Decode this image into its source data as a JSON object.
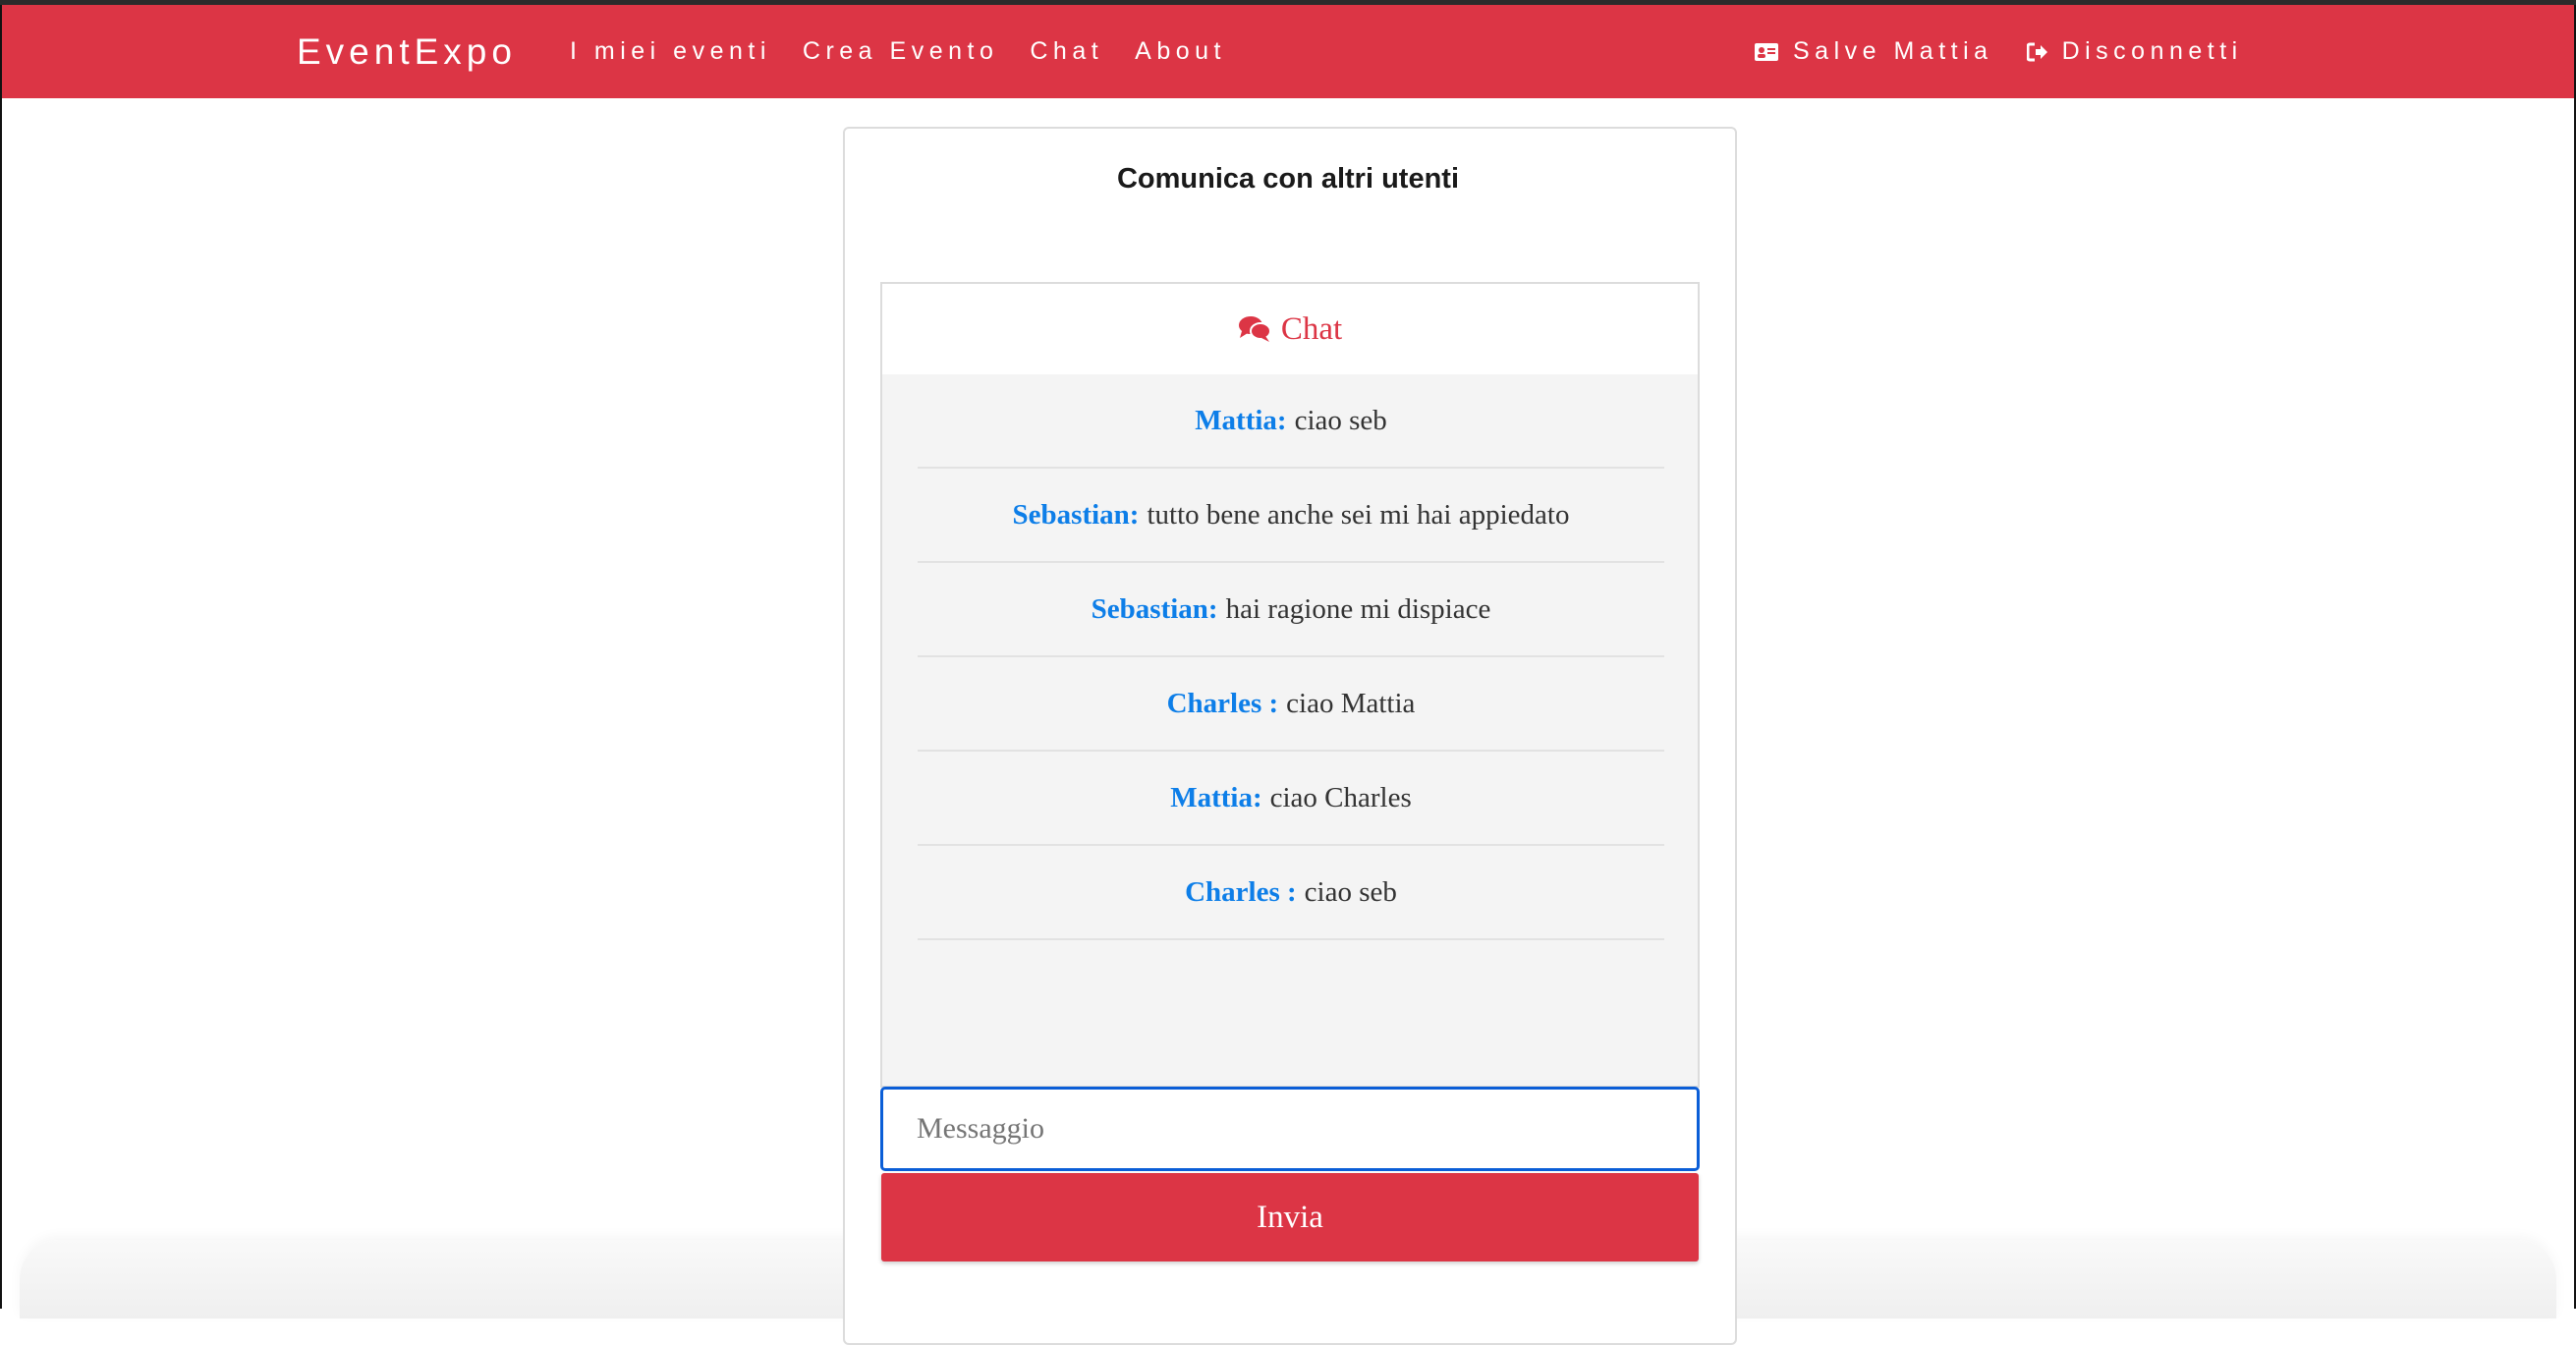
{
  "navbar": {
    "brand": "EventExpo",
    "links": [
      "I miei eventi",
      "Crea Evento",
      "Chat",
      "About"
    ],
    "user_greeting": "Salve Mattia",
    "logout_label": "Disconnetti"
  },
  "page": {
    "title": "Comunica con altri utenti"
  },
  "chat": {
    "header": "Chat",
    "messages": [
      {
        "author": "Mattia:",
        "text": "ciao seb"
      },
      {
        "author": "Sebastian:",
        "text": "tutto bene anche sei mi hai appiedato"
      },
      {
        "author": "Sebastian:",
        "text": "hai ragione mi dispiace"
      },
      {
        "author": "Charles :",
        "text": "ciao Mattia"
      },
      {
        "author": "Mattia:",
        "text": "ciao Charles"
      },
      {
        "author": "Charles :",
        "text": "ciao seb"
      }
    ],
    "input_placeholder": "Messaggio",
    "input_value": "",
    "send_label": "Invia"
  },
  "colors": {
    "brand_red": "#dc3545",
    "author_blue": "#0d7ee8",
    "focus_blue": "#0b5ed7"
  },
  "icons": {
    "user_icon": "id-card-icon",
    "logout_icon": "sign-out-icon",
    "chat_icon": "comments-icon"
  }
}
